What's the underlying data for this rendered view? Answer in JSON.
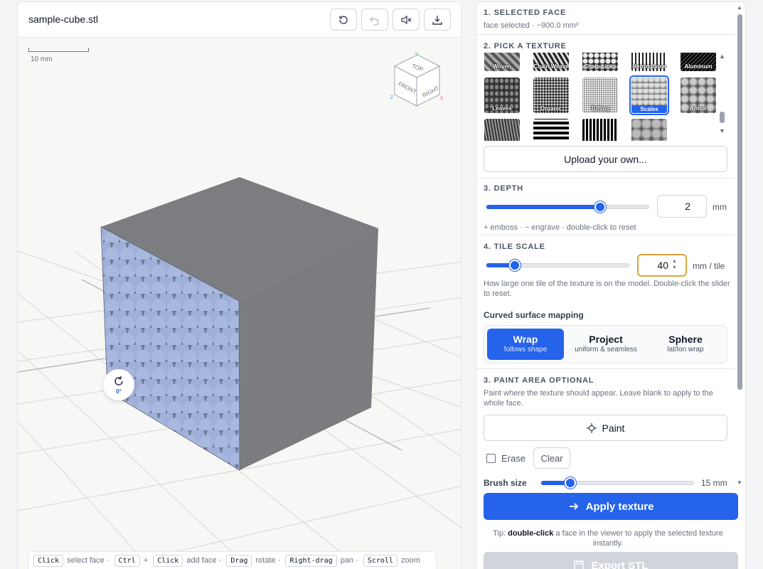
{
  "viewer": {
    "file_title": "sample-cube.stl",
    "toolbar": [
      "reset-view",
      "undo",
      "mute",
      "download"
    ],
    "scale_label": "10 mm",
    "view_cube": {
      "top": "TOP",
      "front": "FRONT",
      "right": "RIGHT",
      "axis_y": "Y",
      "axis_z": "Z",
      "axis_x": "X"
    },
    "rotation_label": "0°",
    "hints": [
      {
        "key": "Click",
        "text": "select face ·"
      },
      {
        "key": "Ctrl",
        "text": "+"
      },
      {
        "key": "Click",
        "text": "add face ·"
      },
      {
        "key": "Drag",
        "text": "rotate ·"
      },
      {
        "key": "Right-drag",
        "text": "pan ·"
      },
      {
        "key": "Scroll",
        "text": "zoom"
      }
    ]
  },
  "panel": {
    "selected_face": {
      "title": "1. SELECTED FACE",
      "info": "face selected · ~900.0 mm²"
    },
    "texture": {
      "title": "2. PICK A TEXTURE",
      "row1": [
        "Woven",
        "Chain Weave",
        "Chain Links",
        "Herringbone",
        "Aluminum"
      ],
      "row2": [
        "Leaves",
        "Organic",
        "Tufting",
        "Scales",
        "Armor"
      ],
      "selected": "Scales",
      "upload_label": "Upload your own..."
    },
    "depth": {
      "title": "3. DEPTH",
      "value": "2",
      "unit": "mm",
      "slider_fraction": 0.7,
      "hint": "+ emboss · − engrave · double-click to reset"
    },
    "tile_scale": {
      "title": "4. TILE SCALE",
      "value": "40",
      "unit": "mm / tile",
      "slider_fraction": 0.2,
      "hint": "How large one tile of the texture is on the model. Double-click the slider to reset.",
      "mapping_title": "Curved surface mapping",
      "mapping_options": [
        {
          "title": "Wrap",
          "sub": "follows shape"
        },
        {
          "title": "Project",
          "sub": "uniform & seamless"
        },
        {
          "title": "Sphere",
          "sub": "lat/lon wrap"
        }
      ],
      "mapping_selected": "Wrap"
    },
    "paint": {
      "title": "3. PAINT AREA OPTIONAL",
      "hint": "Paint where the texture should appear. Leave blank to apply to the whole face.",
      "paint_label": "Paint",
      "erase_label": "Erase",
      "clear_label": "Clear",
      "brush_label": "Brush size",
      "brush_value": "15 mm",
      "brush_fraction": 0.19
    },
    "apply_label": "Apply texture",
    "tip_prefix": "Tip: ",
    "tip_bold": "double-click",
    "tip_rest": " a face in the viewer to apply the selected texture instantly.",
    "export_label": "Export STL"
  },
  "colors": {
    "accent": "#2563eb",
    "focus": "#e0a43a",
    "cube": "#7a7c80",
    "scales": "#a9b8dc"
  }
}
